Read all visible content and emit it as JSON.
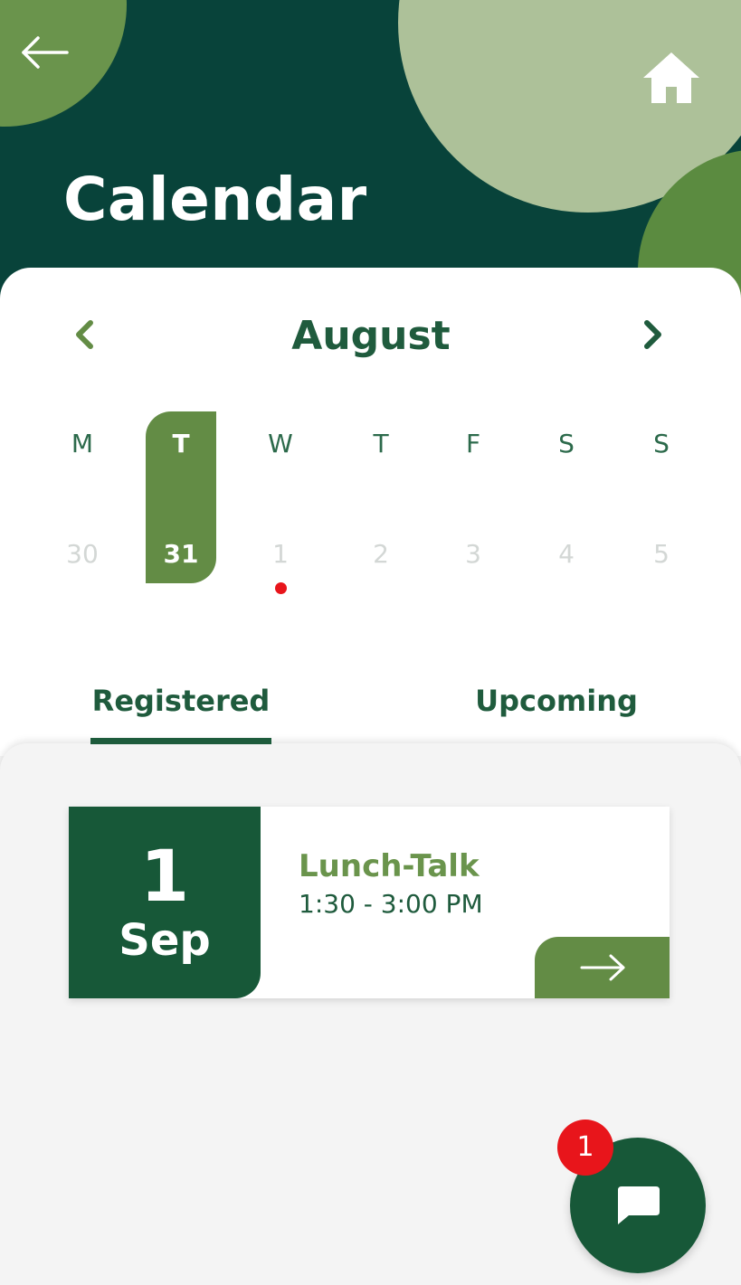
{
  "header": {
    "title": "Calendar"
  },
  "calendar": {
    "month": "August",
    "week": [
      {
        "dow": "M",
        "date": "30",
        "selected": false,
        "has_event": false
      },
      {
        "dow": "T",
        "date": "31",
        "selected": true,
        "has_event": false
      },
      {
        "dow": "W",
        "date": "1",
        "selected": false,
        "has_event": true
      },
      {
        "dow": "T",
        "date": "2",
        "selected": false,
        "has_event": false
      },
      {
        "dow": "F",
        "date": "3",
        "selected": false,
        "has_event": false
      },
      {
        "dow": "S",
        "date": "4",
        "selected": false,
        "has_event": false
      },
      {
        "dow": "S",
        "date": "5",
        "selected": false,
        "has_event": false
      }
    ]
  },
  "tabs": [
    {
      "label": "Registered",
      "active": true
    },
    {
      "label": "Upcoming",
      "active": false
    }
  ],
  "events": [
    {
      "day": "1",
      "month": "Sep",
      "title": "Lunch-Talk",
      "time": "1:30 - 3:00 PM"
    }
  ],
  "chat": {
    "badge_count": "1"
  },
  "icons": {
    "back": "arrow-left-icon",
    "home": "home-icon",
    "prev_month": "chevron-left-icon",
    "next_month": "chevron-right-icon",
    "open_event": "arrow-right-icon",
    "chat": "chat-bubble-icon"
  },
  "colors": {
    "header_bg": "#08433a",
    "primary_green": "#175838",
    "accent_green": "#638c45",
    "light_sage": "#adc199",
    "event_dot": "#e8151b",
    "badge": "#e8151b"
  }
}
